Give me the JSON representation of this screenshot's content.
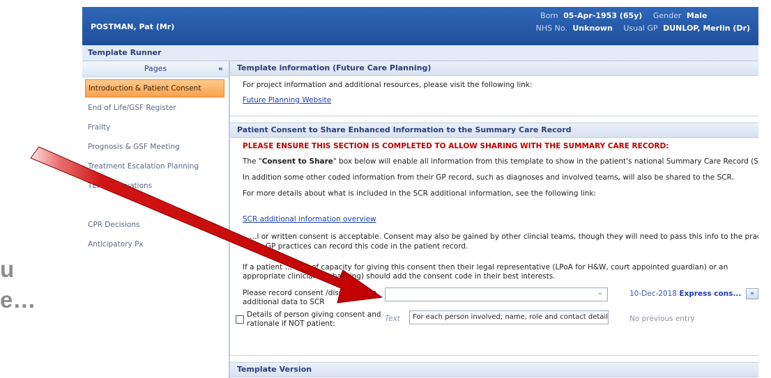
{
  "overlay": {
    "left_line1": "u",
    "left_line2": "e…"
  },
  "patient": {
    "name": "POSTMAN, Pat (Mr)",
    "born_label": "Born",
    "born_value": "05-Apr-1953 (65y)",
    "gender_label": "Gender",
    "gender_value": "Male",
    "nhs_label": "NHS No.",
    "nhs_value": "Unknown",
    "gp_label": "Usual GP",
    "gp_value": "DUNLOP, Merlin (Dr)"
  },
  "runner": {
    "title": "Template Runner"
  },
  "sidebar": {
    "header": "Pages",
    "collapse": "«",
    "items": [
      {
        "label": "Introduction & Patient Consent"
      },
      {
        "label": "End of Life/GSF Register"
      },
      {
        "label": "Frailty"
      },
      {
        "label": "Prognosis & GSF Meeting"
      },
      {
        "label": "Treatment Escalation Planning"
      },
      {
        "label": "TEP Observations"
      },
      {
        "label": ""
      },
      {
        "label": "CPR Decisions"
      },
      {
        "label": "Anticipatory Px"
      }
    ]
  },
  "info_section": {
    "title": "Template information (Future Care Planning)",
    "text": "For project information and additional resources, please visit the following link:",
    "link": "Future Planning Website"
  },
  "consent_section": {
    "title": "Patient Consent to Share Enhanced Information to the Summary Care Record",
    "warning": "PLEASE ENSURE THIS SECTION IS COMPLETED TO ALLOW SHARING WITH THE SUMMARY CARE RECORD:",
    "p1_a": "The \"",
    "p1_b": "Consent to Share",
    "p1_c": "\" box below will enable all information from this template to show in the patient's national Summary Care Record (SCR).",
    "p2": "In addition some other coded information from their GP record, such as diagnoses and involved teams, will also be shared to the SCR.",
    "p3": "For more details about what is included in the SCR additional information, see the following link:",
    "link": "SCR additional information overview",
    "p4_l1": "…l or written consent is acceptable. Consent may also be gained by other clincial teams, though they will need to pass this info to the practice as,",
    "p4_l2": "…ly GP practices can record this code in the patient record.",
    "p5_l1": "If a patient … lack of capacity for giving this consent then their legal representative (LPoA for H&W, court appointed guardian) or an",
    "p5_l2": "appropriate clinician (… backing) should add the consent code in their best interests.",
    "record_label_l1": "Please record consent /dissent t… re",
    "record_label_l2": "additional data to SCR",
    "record_date": "10-Dec-2018",
    "record_express": "Express cons...",
    "details_label_l1": "Details of person giving consent and",
    "details_label_l2": "rationale if NOT patient:",
    "details_text_hint": "Text",
    "details_value": "For each person involved; name, role and contact details",
    "details_prev": "No previous entry"
  },
  "version_section": {
    "title": "Template Version"
  }
}
